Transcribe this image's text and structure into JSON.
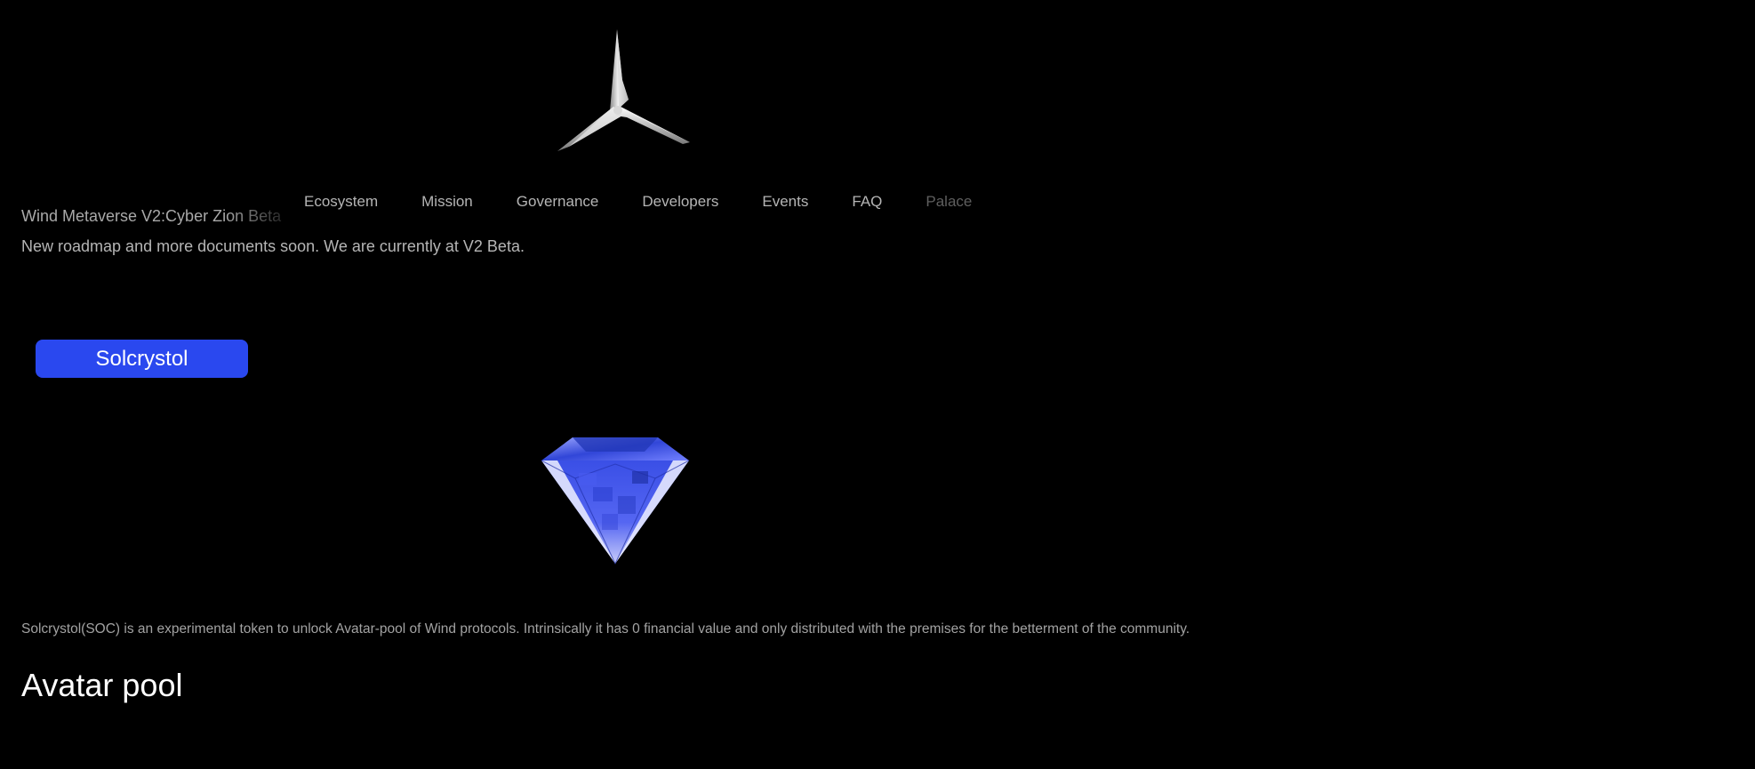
{
  "brand": {
    "logo_icon": "wind-turbine-logo-icon",
    "site_title": "Wind Metaverse V2:Cyber Zion Beta"
  },
  "nav": {
    "items": [
      {
        "label": "Ecosystem"
      },
      {
        "label": "Mission"
      },
      {
        "label": "Governance"
      },
      {
        "label": "Developers"
      },
      {
        "label": "Events"
      },
      {
        "label": "FAQ"
      },
      {
        "label": "Palace"
      }
    ]
  },
  "notice": "New roadmap and more documents soon. We are currently at V2 Beta.",
  "token": {
    "button_label": "Solcrystol",
    "gem_icon": "blue-diamond-icon",
    "description": "Solcrystol(SOC) is an experimental token to unlock Avatar-pool of Wind protocols. Intrinsically it has 0 financial value and only distributed with the premises for the betterment of the community."
  },
  "section": {
    "title": "Avatar pool"
  },
  "colors": {
    "background": "#000000",
    "accent": "#2a48ef",
    "nav_text": "#b5b5b5",
    "nav_text_dim": "#5f5f5f",
    "body_text": "#a2a2a2"
  }
}
